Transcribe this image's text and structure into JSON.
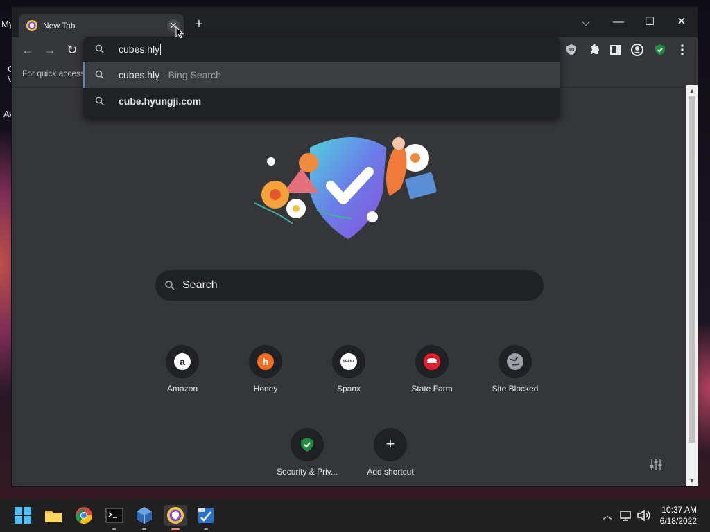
{
  "desktop": {
    "fragments": [
      "My",
      "C",
      "V",
      "Av"
    ]
  },
  "browser": {
    "tab": {
      "title": "New Tab",
      "close_symbol": "✕"
    },
    "new_tab_symbol": "+",
    "window_controls": {
      "dropdown": "⌵",
      "minimize": "—",
      "maximize": "☐",
      "close": "✕"
    },
    "bookmarks_hint": "For quick access,",
    "omnibox": {
      "value": "cubes.hly",
      "suggestions": [
        {
          "text": "cubes.hly",
          "suffix": " - Bing Search",
          "bold": false
        },
        {
          "text": "cube.hyungji.com",
          "suffix": "",
          "bold": true
        }
      ]
    },
    "toolbar_icons": [
      "ad-block-icon",
      "extensions-icon",
      "side-panel-icon",
      "profile-icon",
      "security-shield-icon",
      "menu-icon"
    ]
  },
  "new_tab_page": {
    "search_placeholder": "Search",
    "shortcuts": [
      {
        "label": "Amazon",
        "icon": "amazon-icon",
        "glyph": "a",
        "color": "#ffffff",
        "fg": "#222222"
      },
      {
        "label": "Honey",
        "icon": "honey-icon",
        "glyph": "h",
        "color": "#f26c22",
        "fg": "#ffffff"
      },
      {
        "label": "Spanx",
        "icon": "spanx-icon",
        "glyph": "SPANX",
        "color": "#ffffff",
        "fg": "#222222"
      },
      {
        "label": "State Farm",
        "icon": "state-farm-icon",
        "glyph": "",
        "color": "#e01e2d",
        "fg": "#ffffff"
      },
      {
        "label": "Site Blocked",
        "icon": "globe-icon",
        "glyph": "",
        "color": "#9aa0a6",
        "fg": "#35363a"
      },
      {
        "label": "Security & Priv...",
        "icon": "shield-check-icon",
        "glyph": "✓",
        "color": "#1e8e3e",
        "fg": "#ffffff"
      },
      {
        "label": "Add shortcut",
        "icon": "plus-icon",
        "glyph": "+",
        "color": "#202124",
        "fg": "#e8eaed"
      }
    ]
  },
  "taskbar": {
    "apps": [
      "windows-start-icon",
      "file-explorer-icon",
      "chrome-icon",
      "terminal-icon",
      "virtualbox-icon",
      "secure-browser-icon",
      "ccleaner-icon"
    ],
    "clock": {
      "time": "10:37 AM",
      "date": "6/18/2022"
    }
  },
  "colors": {
    "accent": "#8ab4f8",
    "window_bg": "#35363a",
    "dark_bg": "#202124",
    "text": "#e8eaed"
  }
}
